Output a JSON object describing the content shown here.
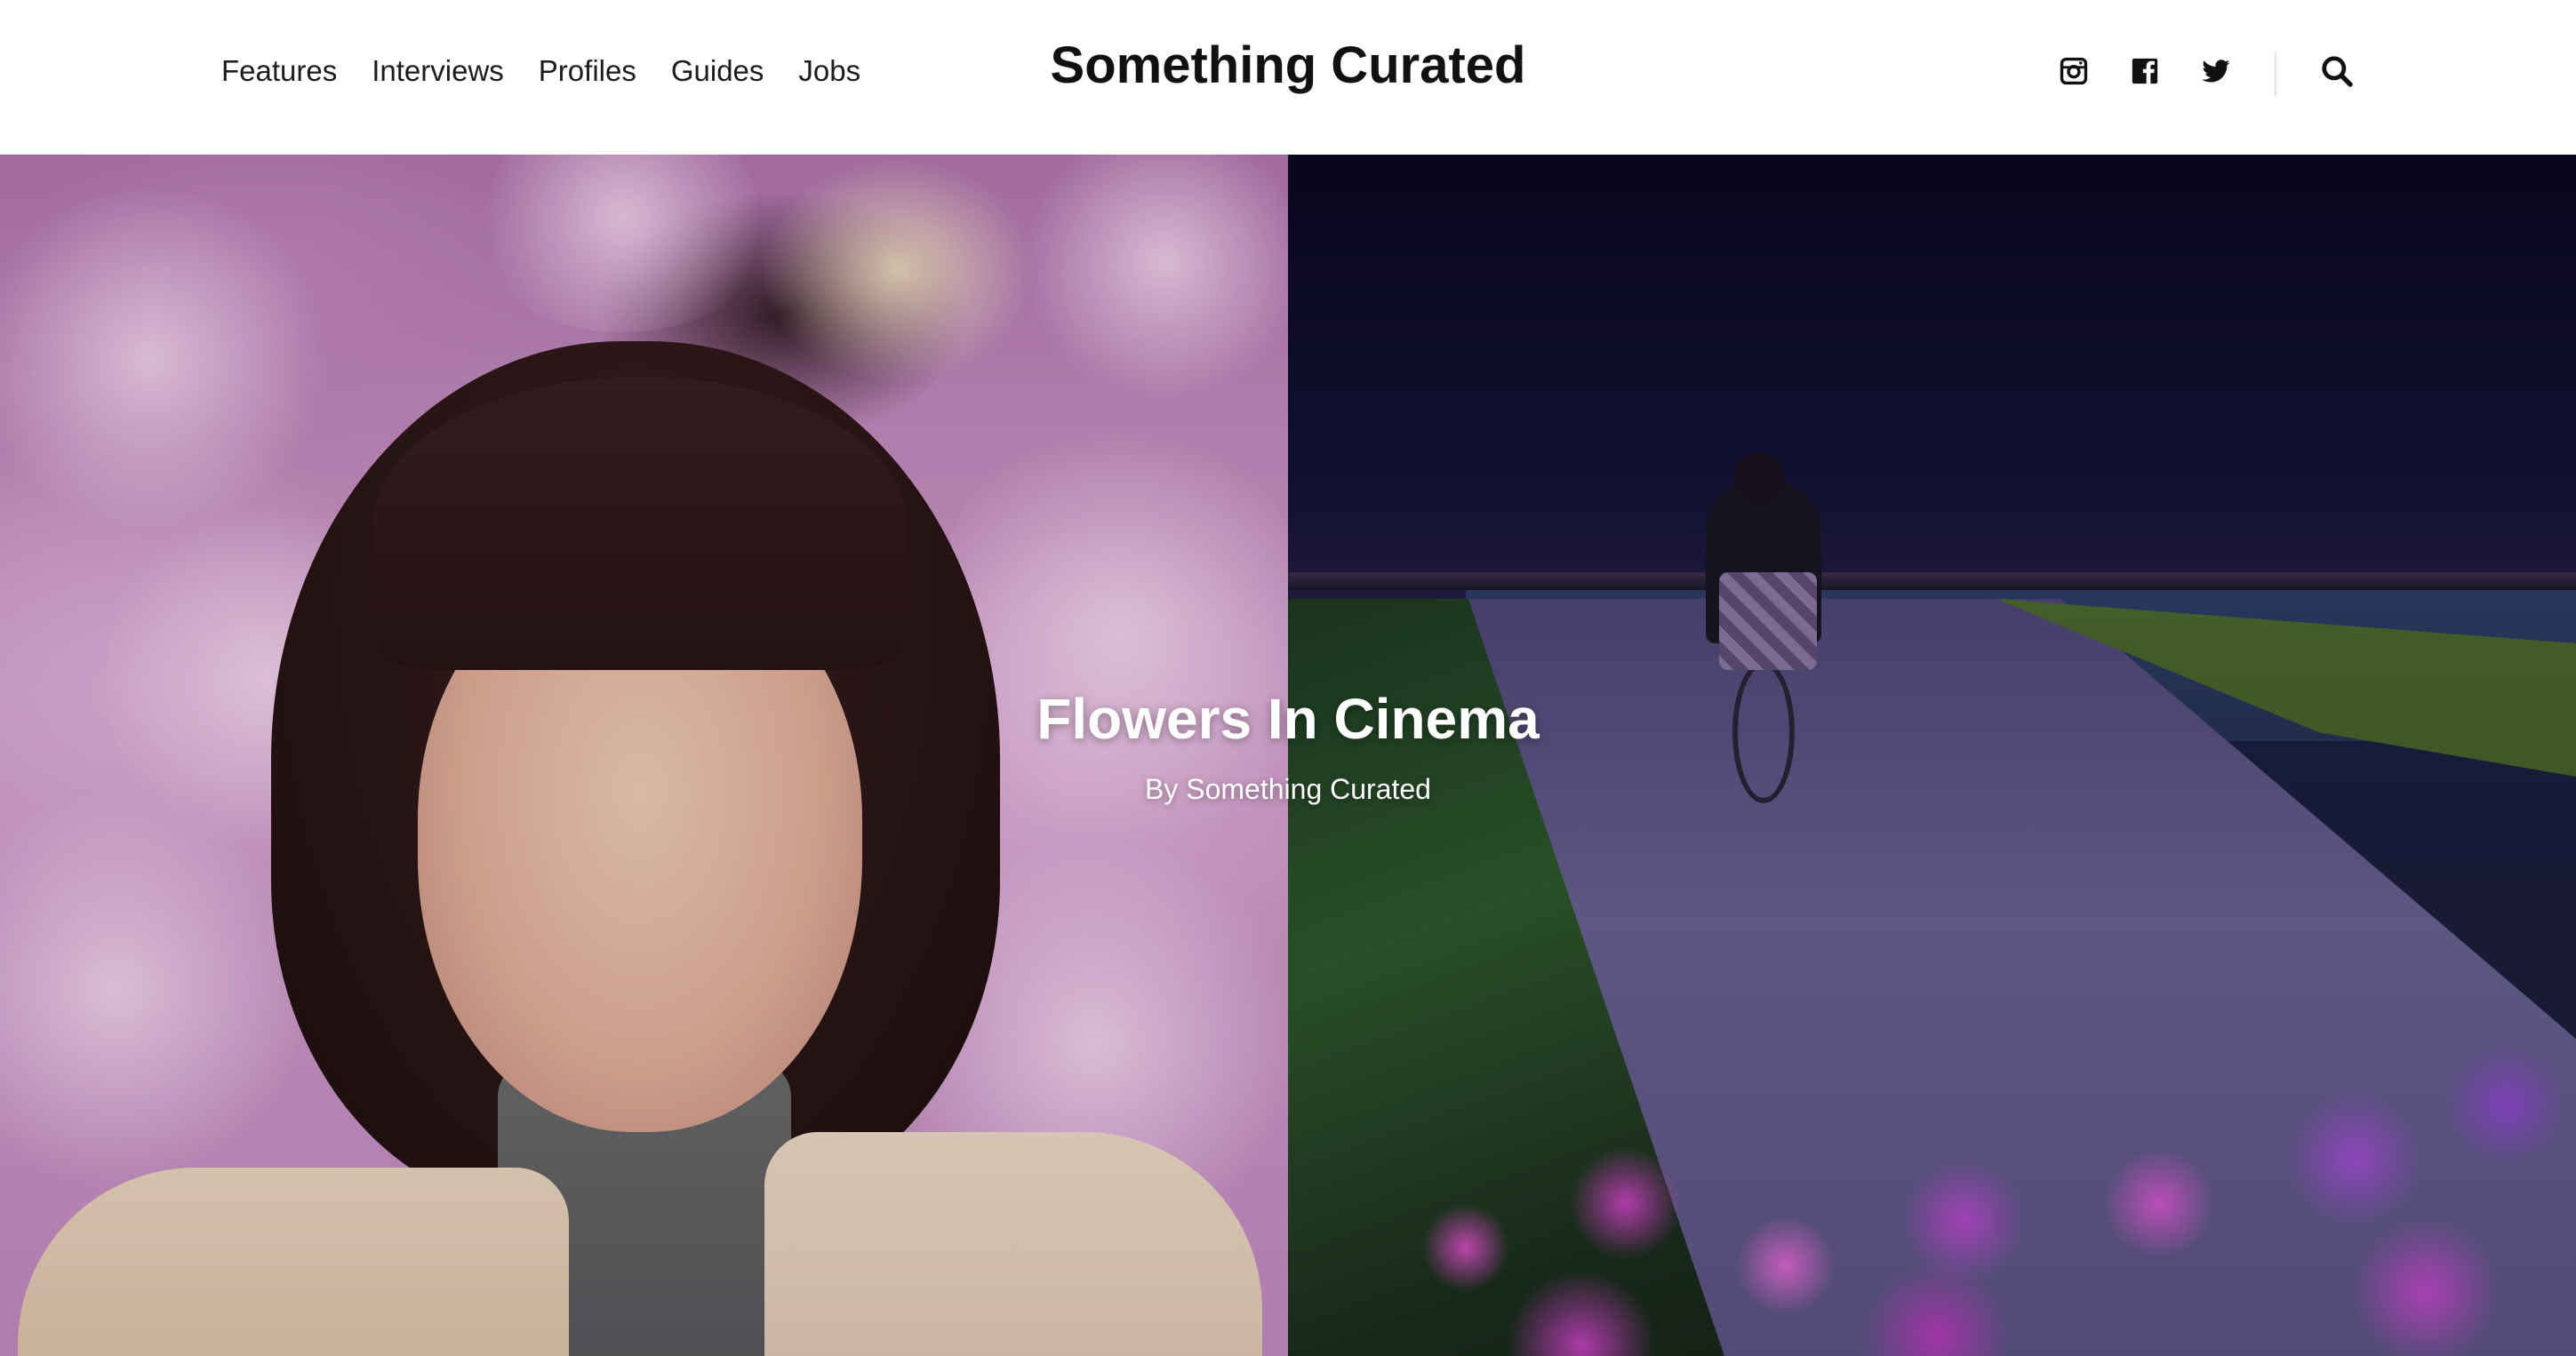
{
  "nav": {
    "items": [
      {
        "label": "Features"
      },
      {
        "label": "Interviews"
      },
      {
        "label": "Profiles"
      },
      {
        "label": "Guides"
      },
      {
        "label": "Jobs"
      }
    ]
  },
  "brand": {
    "name": "Something Curated"
  },
  "header_icons": [
    {
      "name": "instagram-icon"
    },
    {
      "name": "facebook-icon"
    },
    {
      "name": "twitter-icon"
    },
    {
      "name": "search-icon"
    }
  ],
  "hero": {
    "title": "Flowers In Cinema",
    "byline": "By Something Curated",
    "images": [
      {
        "description_icon": "film-still-cherry-blossom-portrait"
      },
      {
        "description_icon": "film-still-night-cyclist"
      }
    ]
  },
  "colors": {
    "header_bg": "#ffffff",
    "text_dark": "#111111",
    "hero_text": "#ffffff",
    "divider": "#e2e2e2"
  }
}
